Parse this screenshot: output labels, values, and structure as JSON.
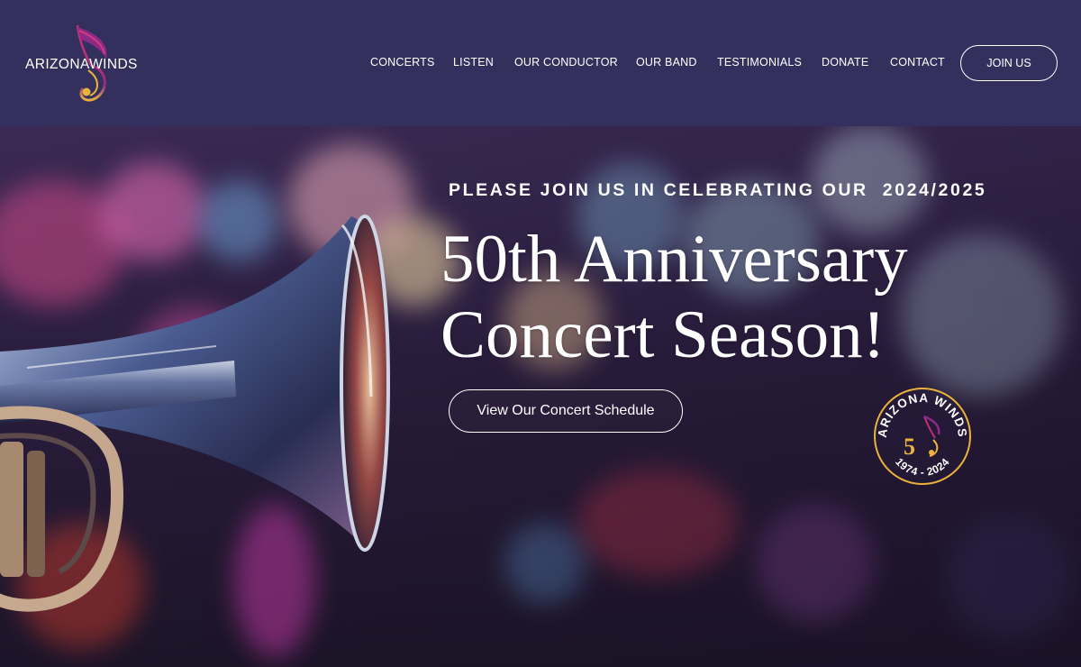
{
  "header": {
    "logo": {
      "text": "ARIZONAWINDS"
    },
    "nav": [
      {
        "label": "CONCERTS"
      },
      {
        "label": "LISTEN"
      },
      {
        "label": "OUR CONDUCTOR"
      },
      {
        "label": "OUR BAND"
      },
      {
        "label": "TESTIMONIALS"
      },
      {
        "label": "DONATE"
      },
      {
        "label": "CONTACT"
      }
    ],
    "join_label": "JOIN US"
  },
  "hero": {
    "eyebrow": "PLEASE JOIN US IN CELEBRATING OUR  2024/2025",
    "headline_line1": "50th Anniversary",
    "headline_line2": "Concert Season!",
    "cta_label": "View Our Concert Schedule",
    "badge": {
      "top_text": "ARIZONA WINDS",
      "bottom_text": "1974 - 2024",
      "number": "5"
    }
  },
  "colors": {
    "header_bg": "#34305e",
    "accent_gold": "#e9b33c",
    "accent_magenta": "#c0307a"
  },
  "icons": [
    "music-note-logo-icon",
    "anniversary-badge-icon"
  ]
}
